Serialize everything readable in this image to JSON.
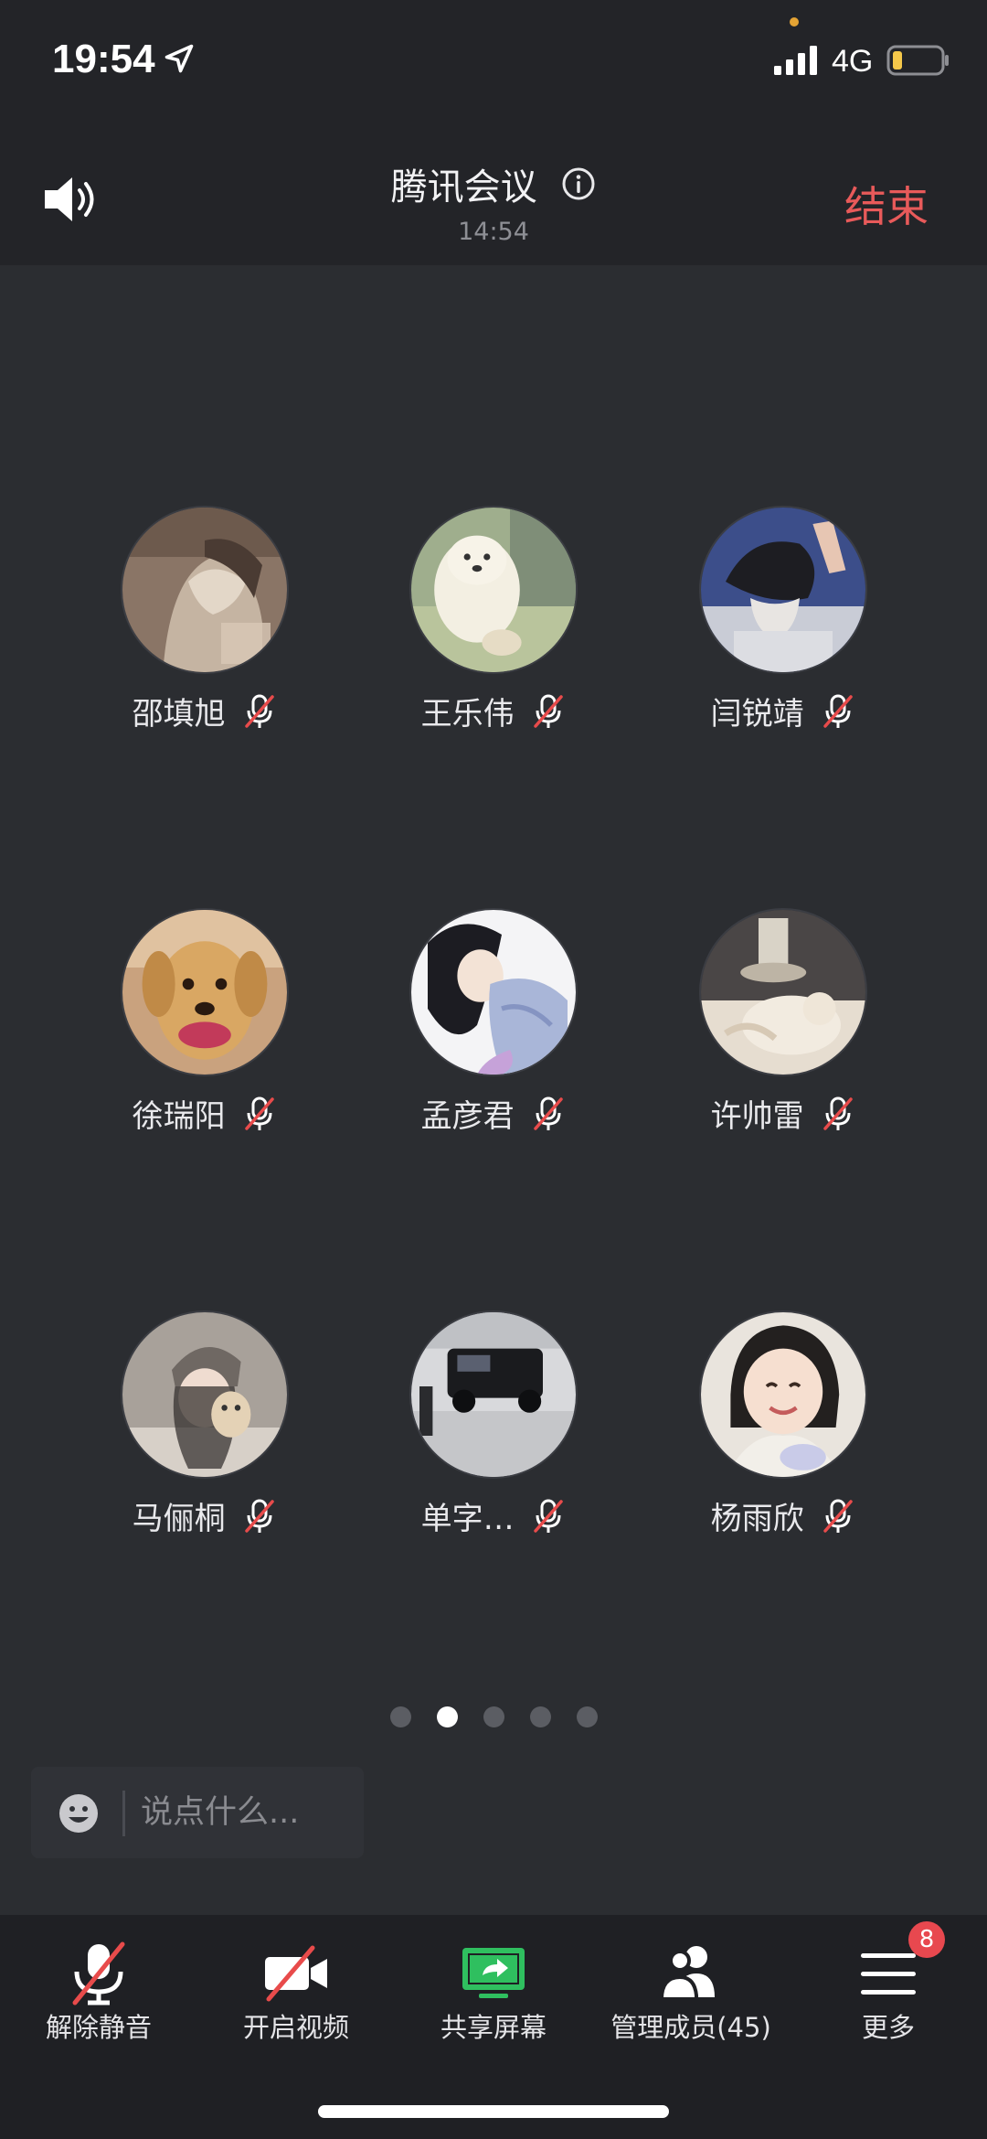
{
  "status_bar": {
    "time": "19:54",
    "network": "4G",
    "icons": [
      "location-arrow-icon",
      "signal-bars-icon",
      "battery-low-icon"
    ],
    "battery_level": 0.2
  },
  "header": {
    "title": "腾讯会议",
    "duration": "14:54",
    "end_label": "结束",
    "icons": [
      "speaker-icon",
      "info-icon"
    ]
  },
  "participants": [
    {
      "name": "邵填旭",
      "muted": true,
      "avatar": "anime-drawing"
    },
    {
      "name": "王乐伟",
      "muted": true,
      "avatar": "white-bear-cartoon"
    },
    {
      "name": "闫锐靖",
      "muted": true,
      "avatar": "person-in-cap"
    },
    {
      "name": "徐瑞阳",
      "muted": true,
      "avatar": "golden-retriever"
    },
    {
      "name": "孟彦君",
      "muted": true,
      "avatar": "anime-girl"
    },
    {
      "name": "许帅雷",
      "muted": true,
      "avatar": "sleeping-kitten"
    },
    {
      "name": "马俪桐",
      "muted": true,
      "avatar": "girl-with-teddy"
    },
    {
      "name": "单字…",
      "muted": true,
      "avatar": "black-suv"
    },
    {
      "name": "杨雨欣",
      "muted": true,
      "avatar": "smiling-child"
    }
  ],
  "pagination": {
    "total": 5,
    "current": 2
  },
  "chat": {
    "placeholder": "说点什么..."
  },
  "toolbar": {
    "unmute_label": "解除静音",
    "video_label": "开启视频",
    "share_label": "共享屏幕",
    "members_label": "管理成员(45)",
    "more_label": "更多",
    "more_badge": "8"
  },
  "colors": {
    "background": "#2b2d31",
    "bar": "#232428",
    "end_red": "#e85a5a",
    "share_green": "#2fbf5f",
    "badge_red": "#e8484f"
  }
}
